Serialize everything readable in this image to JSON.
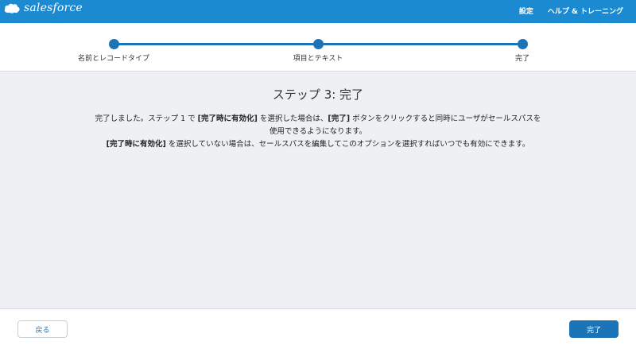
{
  "header": {
    "brand": "salesforce",
    "links": [
      "設定",
      "ヘルプ & トレーニング"
    ]
  },
  "progress": {
    "steps": [
      "名前とレコードタイプ",
      "項目とテキスト",
      "完了"
    ]
  },
  "main": {
    "title": "ステップ 3: 完了",
    "p1_a": "完了しました。ステップ 1 で ",
    "p1_b": "[完了時に有効化]",
    "p1_c": " を選択した場合は、",
    "p1_d": "[完了]",
    "p1_e": " ボタンをクリックすると同時にユーザがセールスパスを使用できるようになります。",
    "p2_a": "[完了時に有効化]",
    "p2_b": " を選択していない場合は、セールスパスを編集してこのオプションを選択すればいつでも有効にできます。"
  },
  "footer": {
    "back_label": "戻る",
    "done_label": "完了"
  },
  "colors": {
    "header_bg": "#1c8ad1",
    "accent": "#1b73b8",
    "content_bg": "#eef0f3"
  }
}
